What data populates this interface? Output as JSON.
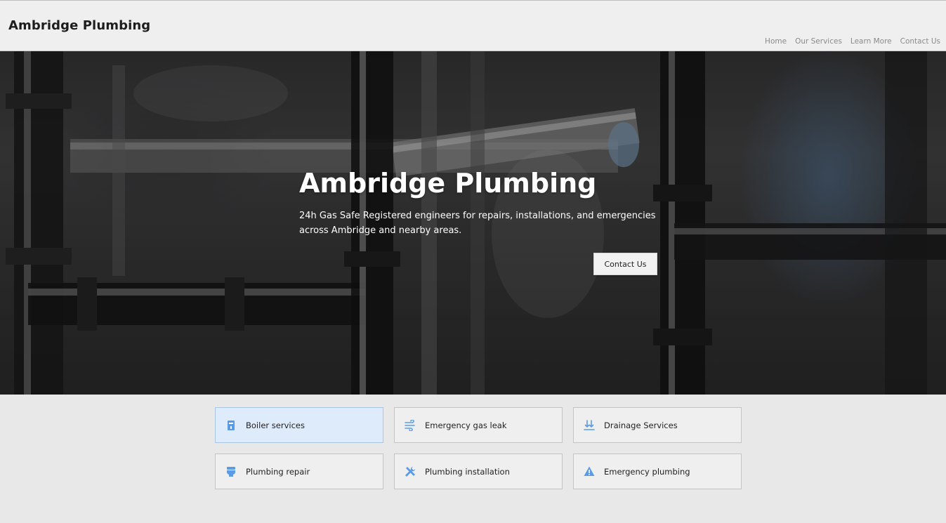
{
  "header": {
    "brand": "Ambridge Plumbing",
    "nav": [
      "Home",
      "Our Services",
      "Learn More",
      "Contact Us"
    ]
  },
  "hero": {
    "title": "Ambridge Plumbing",
    "subtitle": "24h Gas Safe Registered engineers for repairs, installations, and emergencies across Ambridge and nearby areas.",
    "cta": "Contact Us"
  },
  "services": [
    {
      "label": "Boiler services",
      "icon": "boiler-icon",
      "active": true
    },
    {
      "label": "Emergency gas leak",
      "icon": "gas-flow-icon",
      "active": false
    },
    {
      "label": "Drainage Services",
      "icon": "drain-arrows-icon",
      "active": false
    },
    {
      "label": "Plumbing repair",
      "icon": "toilet-icon",
      "active": false
    },
    {
      "label": "Plumbing installation",
      "icon": "tools-icon",
      "active": false
    },
    {
      "label": "Emergency plumbing",
      "icon": "warning-icon",
      "active": false
    }
  ],
  "colors": {
    "accent": "#5b9be6",
    "active_card_bg": "#deebfb",
    "header_bg": "#efefef"
  }
}
